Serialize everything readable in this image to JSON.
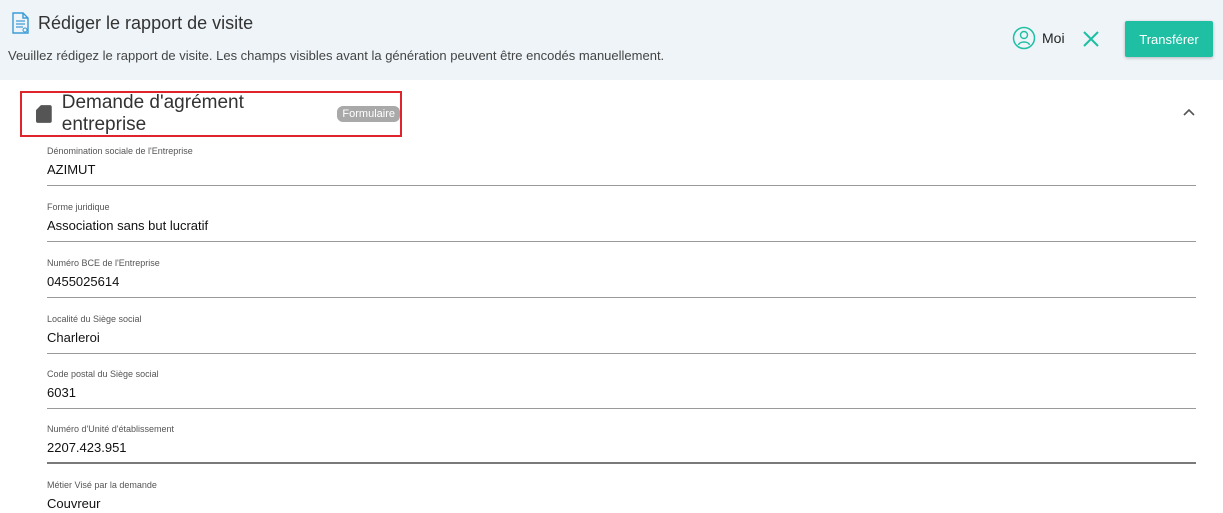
{
  "header": {
    "title": "Rédiger le rapport de visite",
    "subtitle": "Veuillez rédigez le rapport de visite. Les champs visibles avant la génération peuvent être encodés manuellement.",
    "assignee_label": "Moi",
    "transfer_label": "Transférer",
    "icons": {
      "document": "document-icon",
      "user": "user-circle-icon",
      "close": "close-icon"
    },
    "colors": {
      "accent": "#1fbfa3",
      "background": "#eef4f8"
    }
  },
  "section": {
    "title": "Demande d'agrément entreprise",
    "badge": "Formulaire",
    "icons": {
      "card": "sd-card-icon",
      "collapse": "chevron-up-icon"
    },
    "highlight_color": "#e0242c"
  },
  "fields": [
    {
      "label": "Dénomination sociale de l'Entreprise",
      "value": "AZIMUT"
    },
    {
      "label": "Forme juridique",
      "value": "Association sans but lucratif"
    },
    {
      "label": "Numéro BCE de l'Entreprise",
      "value": "0455025614"
    },
    {
      "label": "Localité du Siège social",
      "value": "Charleroi"
    },
    {
      "label": "Code postal du Siège social",
      "value": "6031"
    },
    {
      "label": "Numéro d'Unité d'établissement",
      "value": "2207.423.951"
    },
    {
      "label": "Métier Visé par la demande",
      "value": "Couvreur"
    }
  ]
}
